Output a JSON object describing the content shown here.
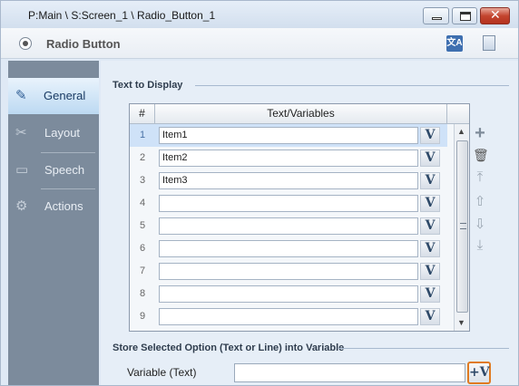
{
  "window": {
    "title": "P:Main \\ S:Screen_1 \\ Radio_Button_1",
    "minimize_glyph": "",
    "maximize_glyph": "",
    "close_glyph": "✕"
  },
  "header": {
    "title": "Radio Button",
    "translate_icon_text": "文A"
  },
  "sidebar": {
    "items": [
      {
        "label": "General",
        "icon": "edit-icon",
        "active": true
      },
      {
        "label": "Layout",
        "icon": "layout-icon",
        "active": false
      },
      {
        "label": "Speech",
        "icon": "speech-icon",
        "active": false
      },
      {
        "label": "Actions",
        "icon": "actions-icon",
        "active": false
      }
    ]
  },
  "main": {
    "section_text": "Text to Display",
    "table": {
      "col_num": "#",
      "col_text": "Text/Variables",
      "rows": [
        {
          "num": "1",
          "value": "Item1",
          "selected": true
        },
        {
          "num": "2",
          "value": "Item2",
          "selected": false
        },
        {
          "num": "3",
          "value": "Item3",
          "selected": false
        },
        {
          "num": "4",
          "value": "",
          "selected": false
        },
        {
          "num": "5",
          "value": "",
          "selected": false
        },
        {
          "num": "6",
          "value": "",
          "selected": false
        },
        {
          "num": "7",
          "value": "",
          "selected": false
        },
        {
          "num": "8",
          "value": "",
          "selected": false
        },
        {
          "num": "9",
          "value": "",
          "selected": false
        }
      ],
      "var_button_label": "V"
    },
    "scroll": {
      "up": "▲",
      "down": "▼"
    },
    "actions": {
      "add": "+",
      "delete": "🗑",
      "move_top": "⤒",
      "move_up": "⇧",
      "move_down": "⇩",
      "move_bottom": "⤓"
    },
    "section_store": "Store Selected Option (Text or Line) into Variable",
    "variable_label": "Variable (Text)",
    "variable_value": "",
    "variable_button_label": "+V"
  }
}
